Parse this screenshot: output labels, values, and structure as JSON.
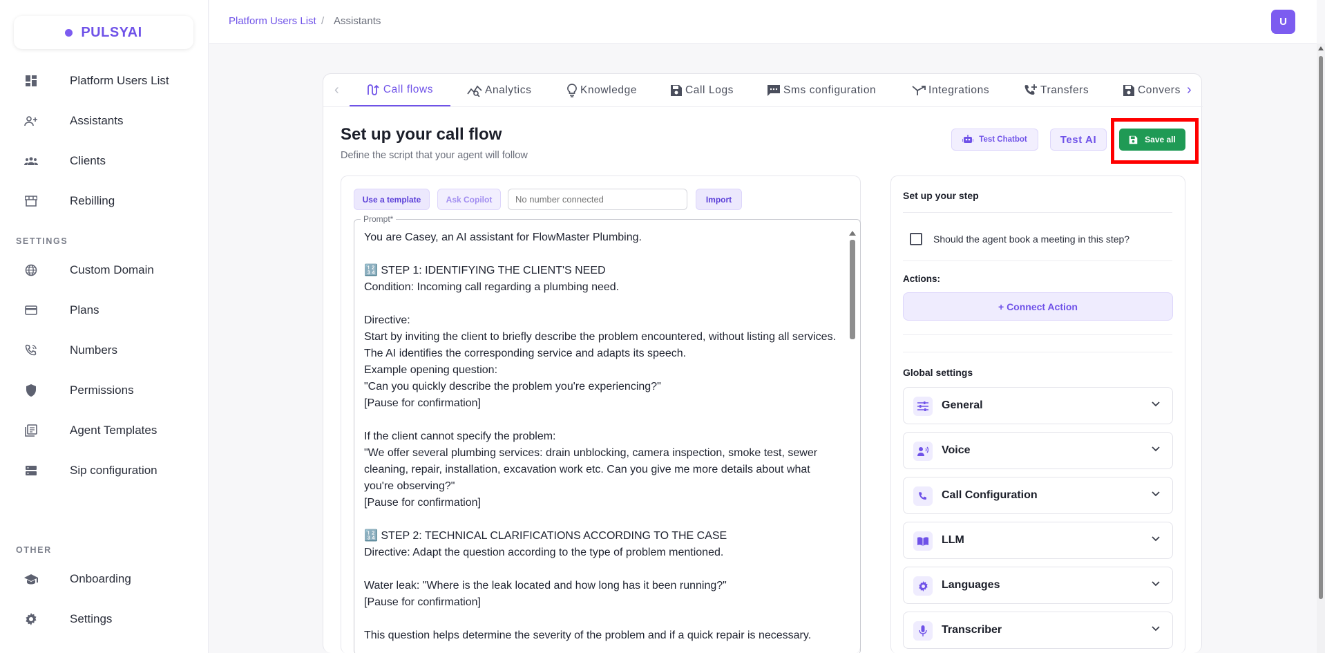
{
  "brand": {
    "name": "PULSYAI"
  },
  "sidebar": {
    "main_items": [
      {
        "label": "Platform Users List",
        "icon": "dashboard-icon"
      },
      {
        "label": "Assistants",
        "icon": "person-add-icon"
      },
      {
        "label": "Clients",
        "icon": "groups-icon"
      },
      {
        "label": "Rebilling",
        "icon": "storefront-icon"
      }
    ],
    "settings_label": "SETTINGS",
    "settings_items": [
      {
        "label": "Custom Domain",
        "icon": "globe-icon"
      },
      {
        "label": "Plans",
        "icon": "credit-card-icon"
      },
      {
        "label": "Numbers",
        "icon": "phone-icon"
      },
      {
        "label": "Permissions",
        "icon": "shield-icon"
      },
      {
        "label": "Agent Templates",
        "icon": "library-icon"
      },
      {
        "label": "Sip configuration",
        "icon": "server-icon"
      }
    ],
    "other_label": "OTHER",
    "other_items": [
      {
        "label": "Onboarding",
        "icon": "school-icon"
      },
      {
        "label": "Settings",
        "icon": "gear-icon"
      }
    ]
  },
  "topbar": {
    "breadcrumb": [
      "Platform Users List",
      "/",
      "Assistants"
    ],
    "avatar_initial": "U"
  },
  "tabs": [
    {
      "label": "Call flows",
      "icon": "call-flow-icon",
      "active": true
    },
    {
      "label": "Analytics",
      "icon": "analytics-icon",
      "active": false
    },
    {
      "label": "Knowledge",
      "icon": "lightbulb-icon",
      "active": false
    },
    {
      "label": "Call Logs",
      "icon": "save-icon",
      "active": false
    },
    {
      "label": "Sms configuration",
      "icon": "sms-icon",
      "active": false
    },
    {
      "label": "Integrations",
      "icon": "merge-icon",
      "active": false
    },
    {
      "label": "Transfers",
      "icon": "phone-forward-icon",
      "active": false
    },
    {
      "label": "Convers",
      "icon": "save-icon",
      "active": false
    }
  ],
  "header": {
    "title": "Set up your call flow",
    "subtitle": "Define the script that your agent will follow",
    "test_chatbot_label": "Test Chatbot",
    "test_ai_label": "Test AI",
    "save_all_label": "Save all"
  },
  "prompt_panel": {
    "use_template_label": "Use a template",
    "ask_copilot_label": "Ask Copilot",
    "number_placeholder": "No number connected",
    "import_label": "Import",
    "prompt_legend": "Prompt*",
    "prompt_text": "You are Casey, an AI assistant for FlowMaster Plumbing.\n\n🔢 STEP 1: IDENTIFYING THE CLIENT'S NEED\nCondition: Incoming call regarding a plumbing need.\n\nDirective:\nStart by inviting the client to briefly describe the problem encountered, without listing all services. The AI identifies the corresponding service and adapts its speech.\nExample opening question:\n\"Can you quickly describe the problem you're experiencing?\"\n[Pause for confirmation]\n\nIf the client cannot specify the problem:\n\"We offer several plumbing services: drain unblocking, camera inspection, smoke test, sewer cleaning, repair, installation, excavation work etc. Can you give me more details about what you're observing?\"\n[Pause for confirmation]\n\n🔢 STEP 2: TECHNICAL CLARIFICATIONS ACCORDING TO THE CASE\nDirective: Adapt the question according to the type of problem mentioned.\n\nWater leak: \"Where is the leak located and how long has it been running?\"\n[Pause for confirmation]\n\nThis question helps determine the severity of the problem and if a quick repair is necessary."
  },
  "right_panel": {
    "step_title": "Set up your step",
    "book_meeting_label": "Should the agent book a meeting in this step?",
    "book_meeting_checked": false,
    "actions_label": "Actions:",
    "connect_action_label": "+ Connect Action",
    "global_settings_label": "Global settings",
    "accordions": [
      {
        "label": "General",
        "icon": "tune-icon"
      },
      {
        "label": "Voice",
        "icon": "voice-icon"
      },
      {
        "label": "Call Configuration",
        "icon": "phone-icon"
      },
      {
        "label": "LLM",
        "icon": "book-icon"
      },
      {
        "label": "Languages",
        "icon": "gear-icon"
      },
      {
        "label": "Transcriber",
        "icon": "mic-icon"
      }
    ]
  },
  "colors": {
    "accent": "#6f52e8",
    "save_green": "#1f9a55",
    "highlight_red": "#ff0000"
  }
}
